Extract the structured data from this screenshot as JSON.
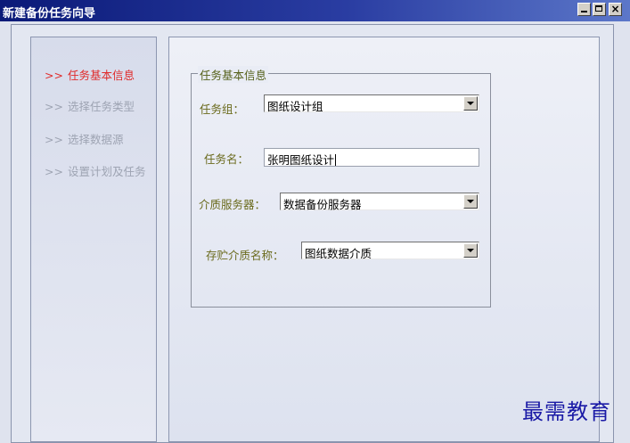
{
  "window": {
    "title": "新建备份任务向导",
    "controls": {
      "minimize_icon": "minimize-icon",
      "maximize_icon": "maximize-icon",
      "close_icon": "close-icon",
      "close_glyph": "×"
    }
  },
  "sidebar": {
    "arrow_glyph": ">>",
    "items": [
      {
        "label": "任务基本信息",
        "active": true
      },
      {
        "label": "选择任务类型",
        "active": false
      },
      {
        "label": "选择数据源",
        "active": false
      },
      {
        "label": "设置计划及任务",
        "active": false
      }
    ]
  },
  "form": {
    "group_title": "任务基本信息",
    "task_group": {
      "label": "任务组：",
      "value": "图纸设计组"
    },
    "task_name": {
      "label": "任务名：",
      "value": "张明图纸设计"
    },
    "media_server": {
      "label": "介质服务器：",
      "value": "数据备份服务器"
    },
    "media_name": {
      "label": "存贮介质名称：",
      "value": "图纸数据介质"
    }
  },
  "watermark": "最需教育",
  "colors": {
    "active_nav": "#e02b2b",
    "inactive_nav": "#9ea4b3",
    "label": "#6a6a1c",
    "titlebar": "#0b1a78"
  }
}
